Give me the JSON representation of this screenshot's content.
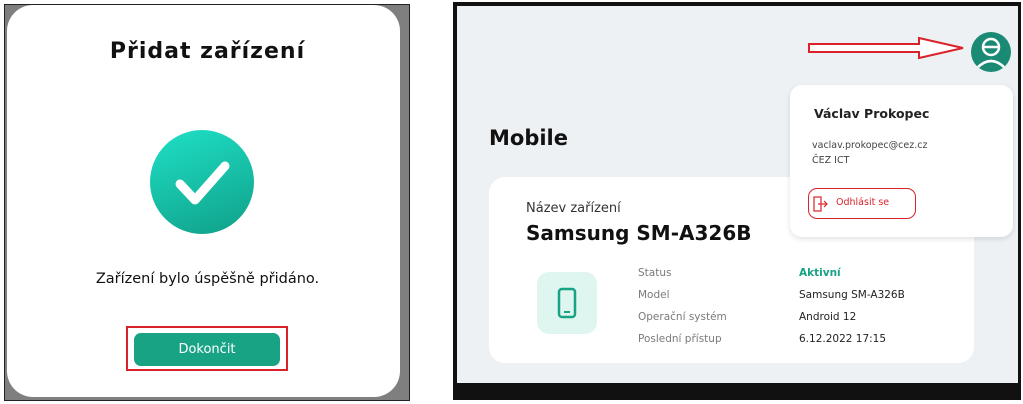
{
  "dialog": {
    "title": "Přidat zařízení",
    "message": "Zařízení bylo úspěšně přidáno.",
    "finish_label": "Dokončit",
    "accent": "#19a385"
  },
  "page": {
    "heading": "Mobile"
  },
  "device": {
    "name_label": "Název zařízení",
    "name": "Samsung SM-A326B",
    "icon": "phone-icon",
    "details": [
      {
        "key": "Status",
        "value": "Aktivní"
      },
      {
        "key": "Model",
        "value": "Samsung SM-A326B"
      },
      {
        "key": "Operační systém",
        "value": "Android 12"
      },
      {
        "key": "Poslední přístup",
        "value": "6.12.2022 17:15"
      }
    ]
  },
  "user_menu": {
    "name": "Václav Prokopec",
    "email": "vaclav.prokopec@cez.cz",
    "org": "ČEZ ICT",
    "logout_label": "Odhlásit se"
  },
  "colors": {
    "annotation_red": "#d9222a",
    "active_green": "#18a284"
  }
}
